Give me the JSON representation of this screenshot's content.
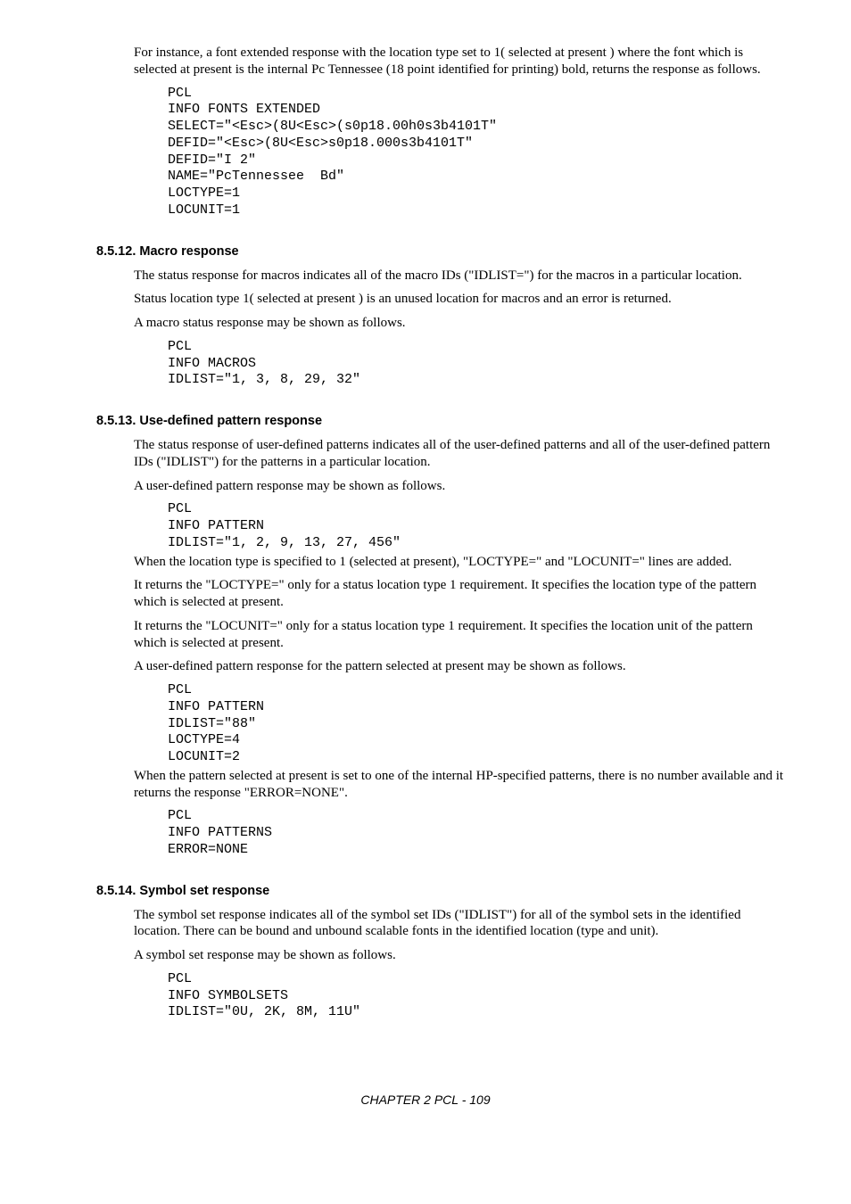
{
  "intro_para": "For instance, a font extended response with the location type set to 1( selected at present ) where the font which is selected at present is the internal Pc Tennessee (18 point identified for printing) bold, returns the response as follows.",
  "code_font_extended": "PCL\nINFO FONTS EXTENDED\nSELECT=\"<Esc>(8U<Esc>(s0p18.00h0s3b4101T\"\nDEFID=\"<Esc>(8U<Esc>s0p18.000s3b4101T\"\nDEFID=\"I 2\"\nNAME=\"PcTennessee  Bd\"\nLOCTYPE=1\nLOCUNIT=1",
  "h_macro": "8.5.12.  Macro response",
  "macro_p1": "The status response for macros indicates all of the macro IDs (\"IDLIST=\") for the macros in a particular location.",
  "macro_p2": "Status location type 1( selected at present ) is an unused location for macros and an error is returned.",
  "macro_p3": "A macro status response may be shown as follows.",
  "code_macro": "PCL\nINFO MACROS\nIDLIST=\"1, 3, 8, 29, 32\"",
  "h_pattern": "8.5.13.  Use-defined pattern response",
  "pattern_p1": "The status response of user-defined patterns indicates all of the user-defined patterns and all of the user-defined pattern IDs (\"IDLIST\") for the patterns in a particular location.",
  "pattern_p2": "A user-defined pattern response may be shown as follows.",
  "code_pattern1": "PCL\nINFO PATTERN\nIDLIST=\"1, 2, 9, 13, 27, 456\"",
  "pattern_p3": "When the location type is specified to 1 (selected at present), \"LOCTYPE=\" and \"LOCUNIT=\" lines are added.",
  "pattern_p4": "It returns the \"LOCTYPE=\" only for a status location type 1 requirement. It specifies the location type of the pattern which is selected at present.",
  "pattern_p5": "It returns the \"LOCUNIT=\" only for a status location type 1 requirement. It specifies the location unit of the pattern which is selected at present.",
  "pattern_p6": "A user-defined pattern response for the pattern selected at present may be shown as follows.",
  "code_pattern2": "PCL\nINFO PATTERN\nIDLIST=\"88\"\nLOCTYPE=4\nLOCUNIT=2",
  "pattern_p7": "When the pattern selected at present is set to one of the internal HP-specified patterns, there is no number available and it returns the response \"ERROR=NONE\".",
  "code_pattern3": "PCL\nINFO PATTERNS\nERROR=NONE",
  "h_symbol": "8.5.14.  Symbol set response",
  "symbol_p1": "The symbol set response indicates all of the symbol set IDs (\"IDLIST\") for all of the symbol sets in the identified location.  There can be bound and  unbound scalable fonts in the identified location (type and unit).",
  "symbol_p2": "A symbol set response may be shown as follows.",
  "code_symbol": "PCL\nINFO SYMBOLSETS\nIDLIST=\"0U, 2K, 8M, 11U\"",
  "footer": "CHAPTER 2 PCL - 109"
}
